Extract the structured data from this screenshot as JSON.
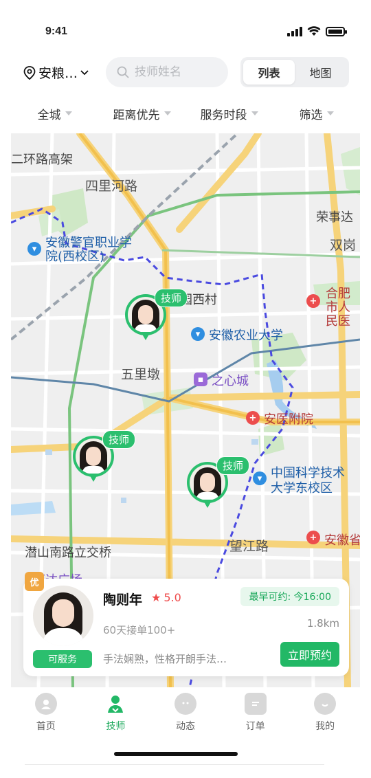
{
  "status_bar": {
    "time": "9:41"
  },
  "top_bar": {
    "location": "安粮…",
    "search_placeholder": "技师姓名",
    "view_toggle": {
      "list": "列表",
      "map": "地图",
      "active": "list"
    }
  },
  "filters": [
    "全城",
    "距离优先",
    "服务时段",
    "筛选"
  ],
  "map": {
    "labels": {
      "road1": "二环路高架",
      "road2": "四里河路",
      "place1": "荣事达",
      "place2": "双岗",
      "school1": "安徽警官职业学院(西校区)",
      "village": "园西村",
      "hospital1": "合肥市人民医",
      "univ1": "安徽农业大学",
      "district": "五里墩",
      "mall": "之心城",
      "hospital2": "安医附院",
      "univ2": "中国科学技术大学东校区",
      "bridge": "潜山南路立交桥",
      "road3": "望江路",
      "hospital3": "安徽省",
      "partial": "万达广场"
    },
    "pins": [
      {
        "tag": "技师"
      },
      {
        "tag": "技师"
      },
      {
        "tag": "技师"
      }
    ]
  },
  "therapist_card": {
    "badge": "优",
    "name": "陶则年",
    "rating": "5.0",
    "earliest": "最早可约: 今16:00",
    "orders": "60天接单100+",
    "distance": "1.8km",
    "description": "手法娴熟，性格开朗手法…",
    "status": "可服务",
    "book_label": "立即预约"
  },
  "tabbar": [
    {
      "label": "首页",
      "icon": "home-icon"
    },
    {
      "label": "技师",
      "icon": "therapist-icon",
      "active": true
    },
    {
      "label": "动态",
      "icon": "moments-icon"
    },
    {
      "label": "订单",
      "icon": "orders-icon"
    },
    {
      "label": "我的",
      "icon": "profile-icon"
    }
  ],
  "colors": {
    "accent": "#22b866",
    "rating": "#ef4c4c",
    "route": "#4a4ae0"
  }
}
